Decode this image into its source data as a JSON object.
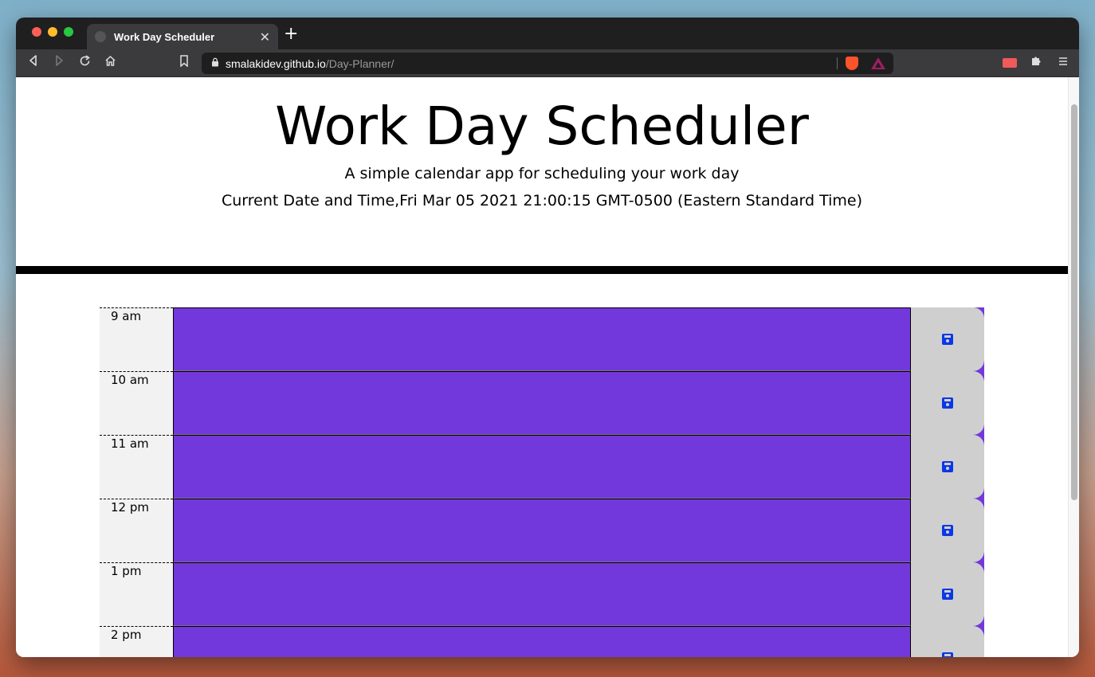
{
  "browser": {
    "tab_title": "Work Day Scheduler",
    "new_tab_symbol": "+",
    "close_tab_symbol": "✕",
    "url_host": "smalakidev.github.io",
    "url_path": "/Day-Planner/"
  },
  "header": {
    "title": "Work Day Scheduler",
    "lead": "A simple calendar app for scheduling your work day",
    "current_datetime": "Current Date and Time,Fri Mar 05 2021 21:00:15 GMT-0500 (Eastern Standard Time)"
  },
  "schedule": {
    "rows": [
      {
        "hour": "9 am",
        "text": ""
      },
      {
        "hour": "10 am",
        "text": ""
      },
      {
        "hour": "11 am",
        "text": ""
      },
      {
        "hour": "12 pm",
        "text": ""
      },
      {
        "hour": "1 pm",
        "text": ""
      },
      {
        "hour": "2 pm",
        "text": ""
      }
    ]
  },
  "colors": {
    "future": "#7338db",
    "save_icon": "#0b38e6",
    "hour_bg": "#f2f2f2"
  },
  "icons": {
    "save": "floppy-disk-icon"
  }
}
